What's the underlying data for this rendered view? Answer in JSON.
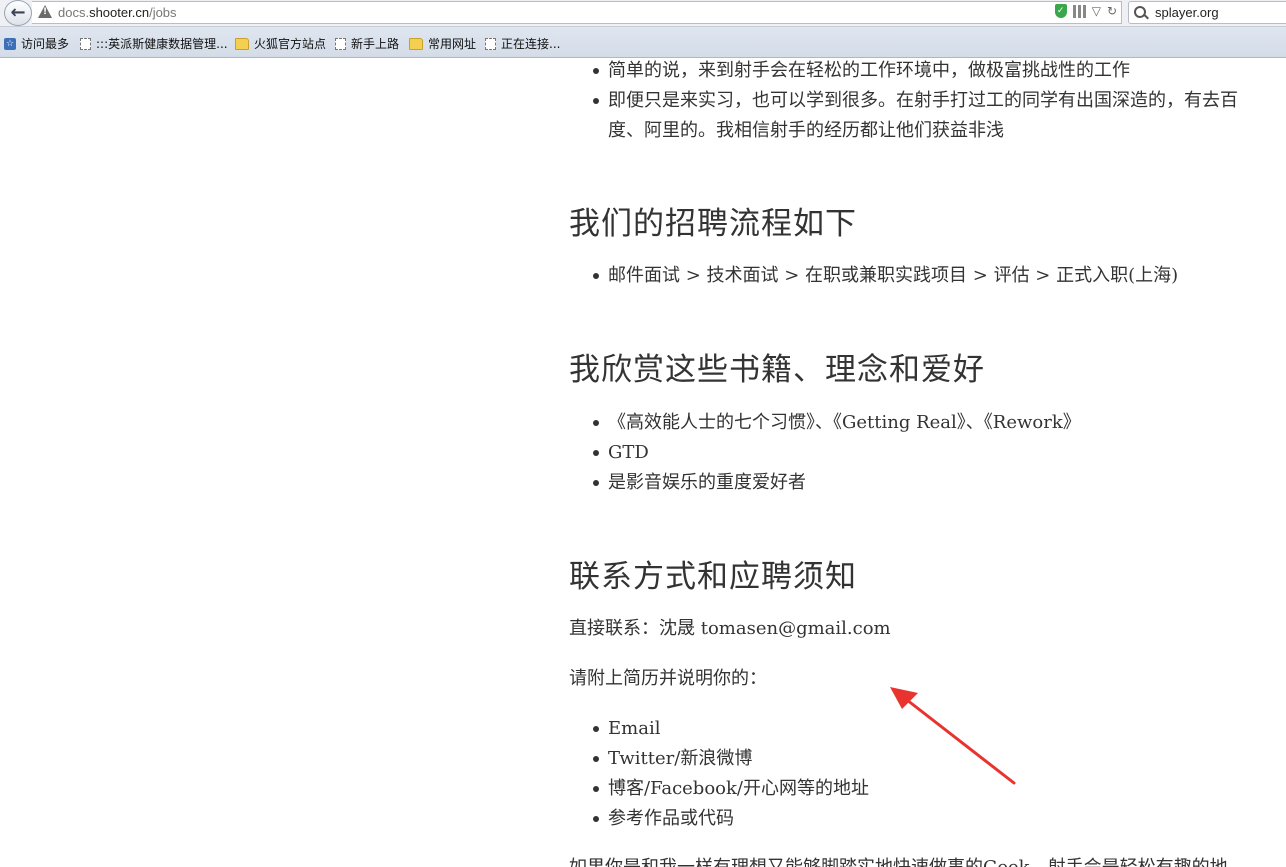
{
  "browser": {
    "url_prefix": "docs.",
    "url_domain": "shooter.cn",
    "url_path": "/jobs",
    "search_value": "splayer.org"
  },
  "bookmarks": [
    {
      "label": "访问最多",
      "icon": "bookmark-star-icon"
    },
    {
      "label": ":::英派斯健康数据管理...",
      "icon": "page-icon"
    },
    {
      "label": "火狐官方站点",
      "icon": "folder-icon"
    },
    {
      "label": "新手上路",
      "icon": "page-icon"
    },
    {
      "label": "常用网址",
      "icon": "folder-icon"
    },
    {
      "label": "正在连接...",
      "icon": "page-icon"
    }
  ],
  "intro_list": [
    "简单的说，来到射手会在轻松的工作环境中，做极富挑战性的工作",
    "即便只是来实习，也可以学到很多。在射手打过工的同学有出国深造的，有去百",
    "度、阿里的。我相信射手的经历都让他们获益非浅"
  ],
  "sections": {
    "process": {
      "heading": "我们的招聘流程如下",
      "items": [
        "邮件面试 > 技术面试 > 在职或兼职实践项目 > 评估 > 正式入职(上海)"
      ]
    },
    "books": {
      "heading": "我欣赏这些书籍、理念和爱好",
      "items": [
        "《高效能人士的七个习惯》、《Getting Real》、《Rework》",
        "GTD",
        "是影音娱乐的重度爱好者"
      ]
    },
    "contact": {
      "heading": "联系方式和应聘须知",
      "direct": "直接联系：沈晟 tomasen@gmail.com",
      "attach": "请附上简历并说明你的：",
      "items": [
        "Email",
        "Twitter/新浪微博",
        "博客/Facebook/开心网等的地址",
        "参考作品或代码"
      ],
      "footer": "如果你是和我一样有理想又能够脚踏实地快速做事的Geek，射手会是轻松有趣的地"
    }
  },
  "annotation_color": "#e8332e"
}
